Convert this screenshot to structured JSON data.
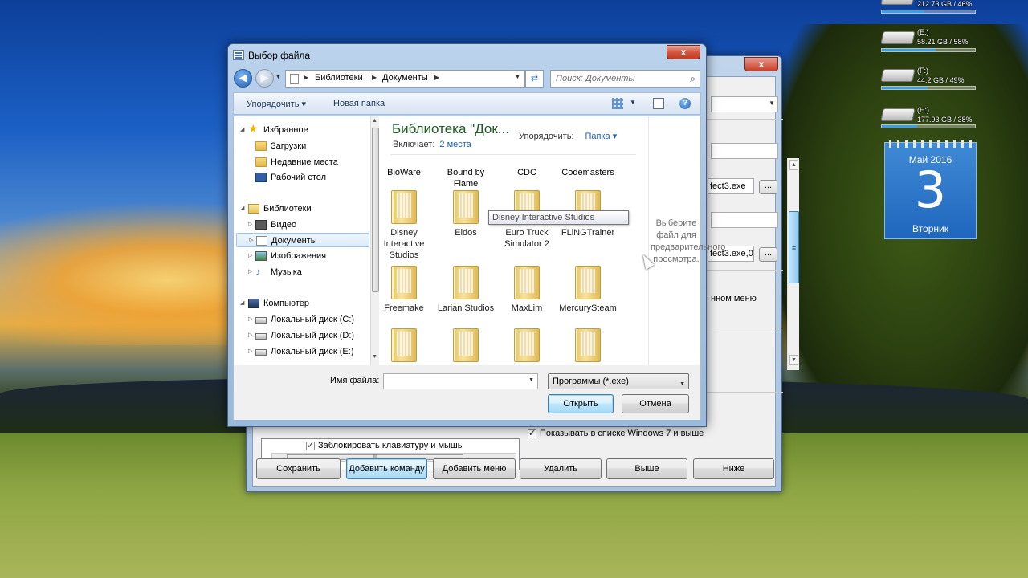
{
  "drives": [
    {
      "name": "",
      "info": "212.73 GB / 46%",
      "fill": 0.46
    },
    {
      "name": "(E:)",
      "info": "58.21 GB / 58%",
      "fill": 0.58
    },
    {
      "name": "(F:)",
      "info": "44.2 GB / 49%",
      "fill": 0.49
    },
    {
      "name": "(H:)",
      "info": "177.93 GB / 38%",
      "fill": 0.38
    }
  ],
  "calendar": {
    "month": "Май 2016",
    "day": "3",
    "weekday": "Вторник"
  },
  "bg_window": {
    "close_glyph": "x",
    "fields": {
      "exe_field": "fect3.exe",
      "exe_field2": "fect3.exe,0"
    },
    "dots_label": "...",
    "menu_text": "нном меню",
    "list_item": "Заблокировать клавиатуру и мышь",
    "hscroll_grip": "III",
    "show_windows7": "Показывать в списке Windows 7 и выше",
    "buttons": {
      "save": "Сохранить",
      "add_command": "Добавить команду",
      "add_menu": "Добавить меню",
      "delete": "Удалить",
      "up": "Выше",
      "down": "Ниже"
    }
  },
  "dialog": {
    "title": "Выбор файла",
    "close_glyph": "x",
    "address": {
      "crumb1": "Библиотеки",
      "crumb2": "Документы"
    },
    "search_placeholder": "Поиск: Документы",
    "toolbar": {
      "organize": "Упорядочить ▾",
      "new_folder": "Новая папка",
      "help": "?"
    },
    "nav": {
      "favorites": "Избранное",
      "downloads": "Загрузки",
      "recent": "Недавние места",
      "desktop": "Рабочий стол",
      "libraries": "Библиотеки",
      "video": "Видео",
      "documents": "Документы",
      "images": "Изображения",
      "music": "Музыка",
      "computer": "Компьютер",
      "disk_c": "Локальный диск (C:)",
      "disk_d": "Локальный диск (D:)",
      "disk_e": "Локальный диск (E:)"
    },
    "library_title": "Библиотека \"Док...",
    "includes_label": "Включает:",
    "includes_link": "2 места",
    "arrange_label": "Упорядочить:",
    "arrange_value": "Папка ▾",
    "folders_top_row": [
      "BioWare",
      "Bound by Flame",
      "CDC",
      "Codemasters"
    ],
    "folders": [
      "Disney Interactive Studios",
      "Eidos",
      "Euro Truck Simulator 2",
      "FLiNGTrainer",
      "Freemake",
      "Larian Studios",
      "MaxLim",
      "MercurySteam"
    ],
    "tooltip": "Disney Interactive Studios",
    "preview_text": "Выберите файл для предварительного просмотра.",
    "file_name_label": "Имя файла:",
    "file_name_value": "",
    "file_type": "Программы (*.exe)",
    "open_button": "Открыть",
    "cancel_button": "Отмена"
  }
}
